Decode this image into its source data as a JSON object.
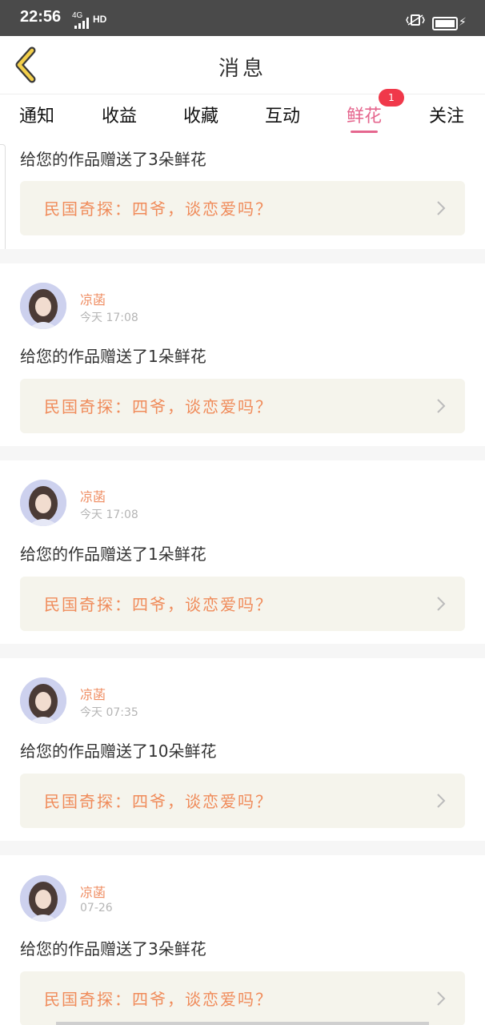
{
  "status_bar": {
    "time": "22:56",
    "network": "4G",
    "hd": "HD"
  },
  "header": {
    "title": "消息"
  },
  "tabs": [
    {
      "label": "通知"
    },
    {
      "label": "收益"
    },
    {
      "label": "收藏"
    },
    {
      "label": "互动"
    },
    {
      "label": "鲜花",
      "active": true,
      "badge": "1"
    },
    {
      "label": "关注"
    }
  ],
  "messages": [
    {
      "message": "给您的作品赠送了3朵鲜花",
      "work_title": "民国奇探：四爷，谈恋爱吗？"
    },
    {
      "user": "凉菡",
      "time": "今天 17:08",
      "message": "给您的作品赠送了1朵鲜花",
      "work_title": "民国奇探：四爷，谈恋爱吗？"
    },
    {
      "user": "凉菡",
      "time": "今天 17:08",
      "message": "给您的作品赠送了1朵鲜花",
      "work_title": "民国奇探：四爷，谈恋爱吗？"
    },
    {
      "user": "凉菡",
      "time": "今天 07:35",
      "message": "给您的作品赠送了10朵鲜花",
      "work_title": "民国奇探：四爷，谈恋爱吗？"
    },
    {
      "user": "凉菡",
      "time": "07-26",
      "message": "给您的作品赠送了3朵鲜花",
      "work_title": "民国奇探：四爷，谈恋爱吗？"
    }
  ],
  "colors": {
    "accent_pink": "#e5668e",
    "username_orange": "#ef8c61",
    "card_bg": "#f5f4ec",
    "badge_red": "#f0384a"
  }
}
